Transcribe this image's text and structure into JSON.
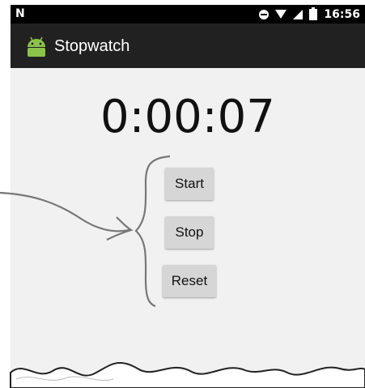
{
  "status_bar": {
    "carrier_glyph": "N",
    "time": "16:56"
  },
  "app_bar": {
    "title": "Stopwatch",
    "icon": "android-icon",
    "color": "#212121"
  },
  "timer": {
    "display": "0:00:07"
  },
  "buttons": {
    "start": "Start",
    "stop": "Stop",
    "reset": "Reset"
  }
}
